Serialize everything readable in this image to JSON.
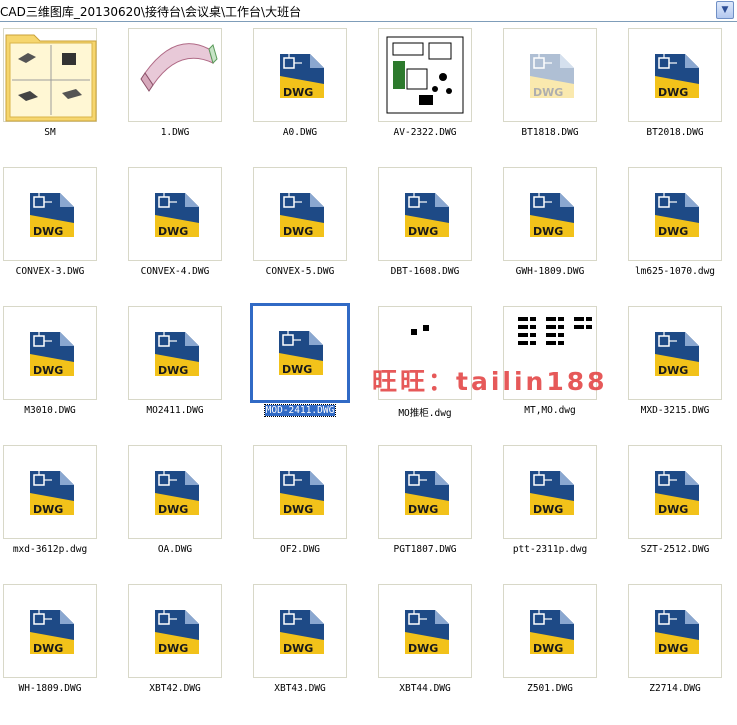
{
  "address": {
    "path": "CAD三维图库_20130620\\接待台\\会议桌\\工作台\\大班台",
    "go_icon": "chevron-down-icon"
  },
  "colors": {
    "selection": "#316ac5",
    "folder": "#f6d66e",
    "dwg_blue": "#1e4a86",
    "dwg_yellow": "#f2c21a",
    "watermark": "#e23c3c"
  },
  "watermark": "旺旺：tailin188",
  "files": [
    {
      "name": "SM",
      "kind": "folder"
    },
    {
      "name": "1.DWG",
      "kind": "preview-sofa"
    },
    {
      "name": "A0.DWG",
      "kind": "dwg"
    },
    {
      "name": "AV-2322.DWG",
      "kind": "preview-plan"
    },
    {
      "name": "BT1818.DWG",
      "kind": "dwg-faded"
    },
    {
      "name": "BT2018.DWG",
      "kind": "dwg"
    },
    {
      "name": "CONVEX-3.DWG",
      "kind": "dwg"
    },
    {
      "name": "CONVEX-4.DWG",
      "kind": "dwg"
    },
    {
      "name": "CONVEX-5.DWG",
      "kind": "dwg"
    },
    {
      "name": "DBT-1608.DWG",
      "kind": "dwg"
    },
    {
      "name": "GWH-1809.DWG",
      "kind": "dwg"
    },
    {
      "name": "lm625-1070.dwg",
      "kind": "dwg"
    },
    {
      "name": "M3010.DWG",
      "kind": "dwg"
    },
    {
      "name": "MO2411.DWG",
      "kind": "dwg"
    },
    {
      "name": "MOD-2411.DWG",
      "kind": "dwg",
      "selected": true
    },
    {
      "name": "MO推柜.dwg",
      "kind": "preview-dots"
    },
    {
      "name": "MT,MO.dwg",
      "kind": "preview-blocks"
    },
    {
      "name": "MXD-3215.DWG",
      "kind": "dwg"
    },
    {
      "name": "mxd-3612p.dwg",
      "kind": "dwg"
    },
    {
      "name": "OA.DWG",
      "kind": "dwg"
    },
    {
      "name": "OF2.DWG",
      "kind": "dwg"
    },
    {
      "name": "PGT1807.DWG",
      "kind": "dwg"
    },
    {
      "name": "ptt-2311p.dwg",
      "kind": "dwg"
    },
    {
      "name": "SZT-2512.DWG",
      "kind": "dwg"
    },
    {
      "name": "WH-1809.DWG",
      "kind": "dwg"
    },
    {
      "name": "XBT42.DWG",
      "kind": "dwg"
    },
    {
      "name": "XBT43.DWG",
      "kind": "dwg"
    },
    {
      "name": "XBT44.DWG",
      "kind": "dwg"
    },
    {
      "name": "Z501.DWG",
      "kind": "dwg"
    },
    {
      "name": "Z2714.DWG",
      "kind": "dwg"
    }
  ]
}
